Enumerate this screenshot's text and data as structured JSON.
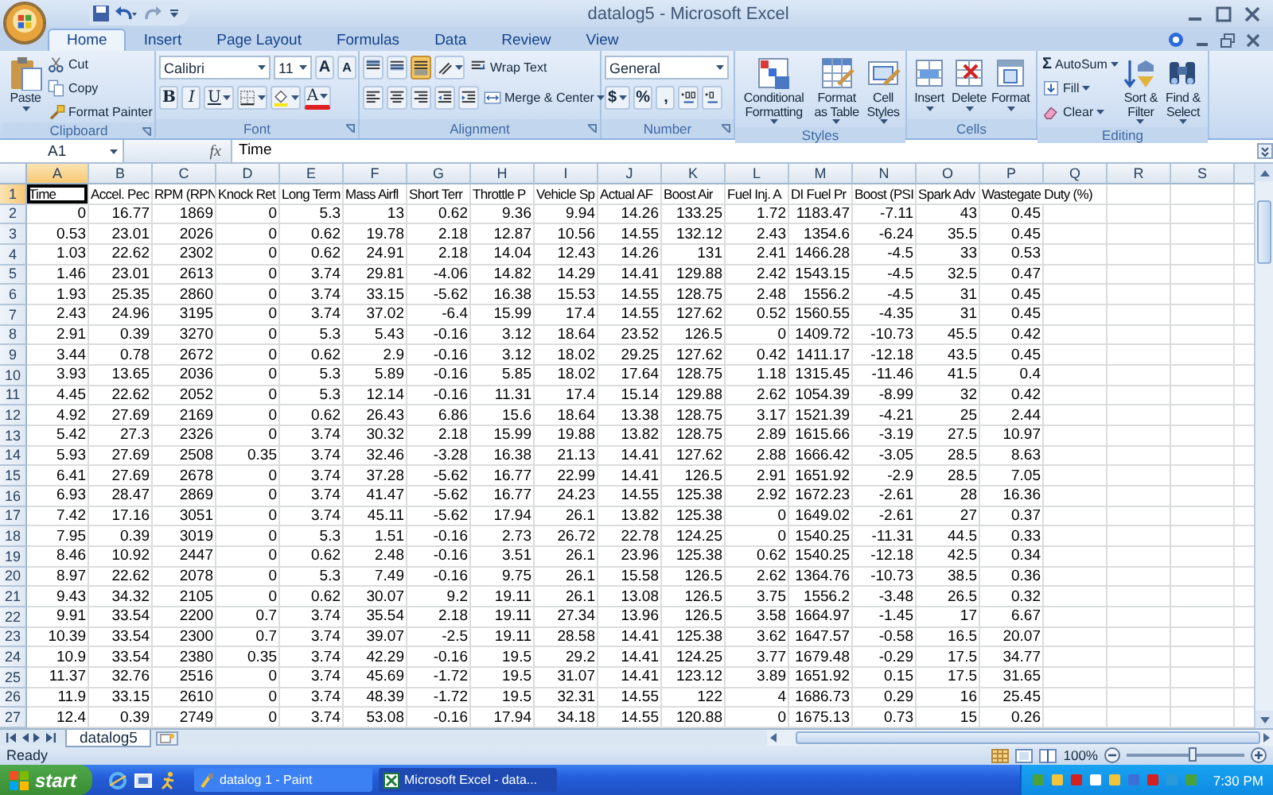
{
  "window": {
    "title": "datalog5 - Microsoft Excel"
  },
  "ribbon_tabs": [
    {
      "label": "Home",
      "selected": true
    },
    {
      "label": "Insert",
      "selected": false
    },
    {
      "label": "Page Layout",
      "selected": false
    },
    {
      "label": "Formulas",
      "selected": false
    },
    {
      "label": "Data",
      "selected": false
    },
    {
      "label": "Review",
      "selected": false
    },
    {
      "label": "View",
      "selected": false
    }
  ],
  "ribbon_groups": [
    {
      "name": "Clipboard",
      "blocks": [
        {
          "kind": "large",
          "label": "Paste",
          "menu": true
        },
        {
          "kind": "stack",
          "rows": [
            {
              "items": [
                {
                  "kind": "small",
                  "label": "Cut",
                  "menu": false
                }
              ]
            },
            {
              "items": [
                {
                  "kind": "small",
                  "label": "Copy",
                  "menu": false
                }
              ]
            },
            {
              "items": [
                {
                  "kind": "small",
                  "label": "Format Painter",
                  "menu": false
                }
              ]
            }
          ]
        }
      ]
    },
    {
      "name": "Font",
      "blocks": [
        {
          "kind": "stack",
          "rows": [
            {
              "items": [
                {
                  "kind": "combo",
                  "value": "Calibri"
                },
                {
                  "kind": "combo",
                  "value": "11"
                },
                {
                  "kind": "glyph",
                  "label": "A",
                  "on": false,
                  "menu": false
                },
                {
                  "kind": "glyph",
                  "label": "A",
                  "on": false,
                  "menu": false
                }
              ]
            },
            {
              "items": [
                {
                  "kind": "glyph",
                  "label": "B",
                  "on": false,
                  "menu": false
                },
                {
                  "kind": "glyph",
                  "label": "I",
                  "on": false,
                  "menu": false
                },
                {
                  "kind": "glyph",
                  "label": "U",
                  "on": false,
                  "menu": true
                },
                {
                  "kind": "tool",
                  "on": false,
                  "menu": true
                },
                {
                  "kind": "tool",
                  "on": false,
                  "menu": true
                },
                {
                  "kind": "glyph",
                  "label": "A",
                  "on": false,
                  "menu": true
                }
              ]
            }
          ]
        }
      ]
    },
    {
      "name": "Alignment",
      "blocks": [
        {
          "kind": "stack",
          "rows": [
            {
              "items": [
                {
                  "kind": "tool",
                  "on": false,
                  "menu": false
                },
                {
                  "kind": "tool",
                  "on": false,
                  "menu": false
                },
                {
                  "kind": "tool",
                  "on": true,
                  "menu": false
                },
                {
                  "kind": "tool",
                  "on": false,
                  "menu": true
                },
                {
                  "kind": "small",
                  "label": "Wrap Text",
                  "menu": false
                }
              ]
            },
            {
              "items": [
                {
                  "kind": "tool",
                  "on": false,
                  "menu": false
                },
                {
                  "kind": "tool",
                  "on": false,
                  "menu": false
                },
                {
                  "kind": "tool",
                  "on": false,
                  "menu": false
                },
                {
                  "kind": "tool",
                  "on": false,
                  "menu": false
                },
                {
                  "kind": "tool",
                  "on": false,
                  "menu": false
                },
                {
                  "kind": "small",
                  "label": "Merge & Center",
                  "menu": true
                }
              ]
            }
          ]
        }
      ]
    },
    {
      "name": "Number",
      "blocks": [
        {
          "kind": "stack",
          "rows": [
            {
              "items": [
                {
                  "kind": "combo",
                  "value": "General"
                }
              ]
            },
            {
              "items": [
                {
                  "kind": "glyph",
                  "label": "$",
                  "on": false,
                  "menu": true
                },
                {
                  "kind": "glyph",
                  "label": "%",
                  "on": false,
                  "menu": false
                },
                {
                  "kind": "glyph",
                  "label": ",",
                  "on": false,
                  "menu": false
                },
                {
                  "kind": "tool",
                  "on": false,
                  "menu": false
                },
                {
                  "kind": "tool",
                  "on": false,
                  "menu": false
                }
              ]
            }
          ]
        }
      ]
    },
    {
      "name": "Styles",
      "blocks": [
        {
          "kind": "large",
          "label": "Conditional Formatting",
          "menu": true
        },
        {
          "kind": "large",
          "label": "Format as Table",
          "menu": true
        },
        {
          "kind": "large",
          "label": "Cell Styles",
          "menu": true
        }
      ]
    },
    {
      "name": "Cells",
      "blocks": [
        {
          "kind": "large",
          "label": "Insert",
          "menu": true
        },
        {
          "kind": "large",
          "label": "Delete",
          "menu": true
        },
        {
          "kind": "large",
          "label": "Format",
          "menu": true
        }
      ]
    },
    {
      "name": "Editing",
      "blocks": [
        {
          "kind": "stack",
          "rows": [
            {
              "items": [
                {
                  "kind": "small",
                  "symbol": "Σ",
                  "label": "AutoSum",
                  "menu": true
                }
              ]
            },
            {
              "items": [
                {
                  "kind": "small",
                  "label": "Fill",
                  "menu": true
                }
              ]
            },
            {
              "items": [
                {
                  "kind": "small",
                  "label": "Clear",
                  "menu": true
                }
              ]
            }
          ]
        },
        {
          "kind": "large",
          "label": "Sort & Filter",
          "menu": true
        },
        {
          "kind": "large",
          "label": "Find & Select",
          "menu": true
        }
      ]
    }
  ],
  "formula_bar": {
    "name_box": "A1",
    "fx": "fx",
    "formula": "Time"
  },
  "sheet": {
    "columns": [
      {
        "label": "A",
        "selected": true
      },
      {
        "label": "B",
        "selected": false
      },
      {
        "label": "C",
        "selected": false
      },
      {
        "label": "D",
        "selected": false
      },
      {
        "label": "E",
        "selected": false
      },
      {
        "label": "F",
        "selected": false
      },
      {
        "label": "G",
        "selected": false
      },
      {
        "label": "H",
        "selected": false
      },
      {
        "label": "I",
        "selected": false
      },
      {
        "label": "J",
        "selected": false
      },
      {
        "label": "K",
        "selected": false
      },
      {
        "label": "L",
        "selected": false
      },
      {
        "label": "M",
        "selected": false
      },
      {
        "label": "N",
        "selected": false
      },
      {
        "label": "O",
        "selected": false
      },
      {
        "label": "P",
        "selected": false
      },
      {
        "label": "Q",
        "selected": false
      },
      {
        "label": "R",
        "selected": false
      },
      {
        "label": "S",
        "selected": false
      }
    ],
    "rows": [
      {
        "number": "1",
        "selected": true,
        "cells": [
          "Time",
          "Accel. Pec",
          "RPM (RPN",
          "Knock Ret",
          "Long Term",
          "Mass Airfl",
          "Short Terr",
          "Throttle P",
          "Vehicle Sp",
          "Actual AF",
          "Boost Air",
          "Fuel Inj. A",
          "DI Fuel Pr",
          "Boost (PSI",
          "Spark Adv",
          "Wastegate Duty (%)"
        ]
      },
      {
        "number": "2",
        "selected": false,
        "cells": [
          "0",
          "16.77",
          "1869",
          "0",
          "5.3",
          "13",
          "0.62",
          "9.36",
          "9.94",
          "14.26",
          "133.25",
          "1.72",
          "1183.47",
          "-7.11",
          "43",
          "0.45"
        ]
      },
      {
        "number": "3",
        "selected": false,
        "cells": [
          "0.53",
          "23.01",
          "2026",
          "0",
          "0.62",
          "19.78",
          "2.18",
          "12.87",
          "10.56",
          "14.55",
          "132.12",
          "2.43",
          "1354.6",
          "-6.24",
          "35.5",
          "0.45"
        ]
      },
      {
        "number": "4",
        "selected": false,
        "cells": [
          "1.03",
          "22.62",
          "2302",
          "0",
          "0.62",
          "24.91",
          "2.18",
          "14.04",
          "12.43",
          "14.26",
          "131",
          "2.41",
          "1466.28",
          "-4.5",
          "33",
          "0.53"
        ]
      },
      {
        "number": "5",
        "selected": false,
        "cells": [
          "1.46",
          "23.01",
          "2613",
          "0",
          "3.74",
          "29.81",
          "-4.06",
          "14.82",
          "14.29",
          "14.41",
          "129.88",
          "2.42",
          "1543.15",
          "-4.5",
          "32.5",
          "0.47"
        ]
      },
      {
        "number": "6",
        "selected": false,
        "cells": [
          "1.93",
          "25.35",
          "2860",
          "0",
          "3.74",
          "33.15",
          "-5.62",
          "16.38",
          "15.53",
          "14.55",
          "128.75",
          "2.48",
          "1556.2",
          "-4.5",
          "31",
          "0.45"
        ]
      },
      {
        "number": "7",
        "selected": false,
        "cells": [
          "2.43",
          "24.96",
          "3195",
          "0",
          "3.74",
          "37.02",
          "-6.4",
          "15.99",
          "17.4",
          "14.55",
          "127.62",
          "0.52",
          "1560.55",
          "-4.35",
          "31",
          "0.45"
        ]
      },
      {
        "number": "8",
        "selected": false,
        "cells": [
          "2.91",
          "0.39",
          "3270",
          "0",
          "5.3",
          "5.43",
          "-0.16",
          "3.12",
          "18.64",
          "23.52",
          "126.5",
          "0",
          "1409.72",
          "-10.73",
          "45.5",
          "0.42"
        ]
      },
      {
        "number": "9",
        "selected": false,
        "cells": [
          "3.44",
          "0.78",
          "2672",
          "0",
          "0.62",
          "2.9",
          "-0.16",
          "3.12",
          "18.02",
          "29.25",
          "127.62",
          "0.42",
          "1411.17",
          "-12.18",
          "43.5",
          "0.45"
        ]
      },
      {
        "number": "10",
        "selected": false,
        "cells": [
          "3.93",
          "13.65",
          "2036",
          "0",
          "5.3",
          "5.89",
          "-0.16",
          "5.85",
          "18.02",
          "17.64",
          "128.75",
          "1.18",
          "1315.45",
          "-11.46",
          "41.5",
          "0.4"
        ]
      },
      {
        "number": "11",
        "selected": false,
        "cells": [
          "4.45",
          "22.62",
          "2052",
          "0",
          "5.3",
          "12.14",
          "-0.16",
          "11.31",
          "17.4",
          "15.14",
          "129.88",
          "2.62",
          "1054.39",
          "-8.99",
          "32",
          "0.42"
        ]
      },
      {
        "number": "12",
        "selected": false,
        "cells": [
          "4.92",
          "27.69",
          "2169",
          "0",
          "0.62",
          "26.43",
          "6.86",
          "15.6",
          "18.64",
          "13.38",
          "128.75",
          "3.17",
          "1521.39",
          "-4.21",
          "25",
          "2.44"
        ]
      },
      {
        "number": "13",
        "selected": false,
        "cells": [
          "5.42",
          "27.3",
          "2326",
          "0",
          "3.74",
          "30.32",
          "2.18",
          "15.99",
          "19.88",
          "13.82",
          "128.75",
          "2.89",
          "1615.66",
          "-3.19",
          "27.5",
          "10.97"
        ]
      },
      {
        "number": "14",
        "selected": false,
        "cells": [
          "5.93",
          "27.69",
          "2508",
          "0.35",
          "3.74",
          "32.46",
          "-3.28",
          "16.38",
          "21.13",
          "14.41",
          "127.62",
          "2.88",
          "1666.42",
          "-3.05",
          "28.5",
          "8.63"
        ]
      },
      {
        "number": "15",
        "selected": false,
        "cells": [
          "6.41",
          "27.69",
          "2678",
          "0",
          "3.74",
          "37.28",
          "-5.62",
          "16.77",
          "22.99",
          "14.41",
          "126.5",
          "2.91",
          "1651.92",
          "-2.9",
          "28.5",
          "7.05"
        ]
      },
      {
        "number": "16",
        "selected": false,
        "cells": [
          "6.93",
          "28.47",
          "2869",
          "0",
          "3.74",
          "41.47",
          "-5.62",
          "16.77",
          "24.23",
          "14.55",
          "125.38",
          "2.92",
          "1672.23",
          "-2.61",
          "28",
          "16.36"
        ]
      },
      {
        "number": "17",
        "selected": false,
        "cells": [
          "7.42",
          "17.16",
          "3051",
          "0",
          "3.74",
          "45.11",
          "-5.62",
          "17.94",
          "26.1",
          "13.82",
          "125.38",
          "0",
          "1649.02",
          "-2.61",
          "27",
          "0.37"
        ]
      },
      {
        "number": "18",
        "selected": false,
        "cells": [
          "7.95",
          "0.39",
          "3019",
          "0",
          "5.3",
          "1.51",
          "-0.16",
          "2.73",
          "26.72",
          "22.78",
          "124.25",
          "0",
          "1540.25",
          "-11.31",
          "44.5",
          "0.33"
        ]
      },
      {
        "number": "19",
        "selected": false,
        "cells": [
          "8.46",
          "10.92",
          "2447",
          "0",
          "0.62",
          "2.48",
          "-0.16",
          "3.51",
          "26.1",
          "23.96",
          "125.38",
          "0.62",
          "1540.25",
          "-12.18",
          "42.5",
          "0.34"
        ]
      },
      {
        "number": "20",
        "selected": false,
        "cells": [
          "8.97",
          "22.62",
          "2078",
          "0",
          "5.3",
          "7.49",
          "-0.16",
          "9.75",
          "26.1",
          "15.58",
          "126.5",
          "2.62",
          "1364.76",
          "-10.73",
          "38.5",
          "0.36"
        ]
      },
      {
        "number": "21",
        "selected": false,
        "cells": [
          "9.43",
          "34.32",
          "2105",
          "0",
          "0.62",
          "30.07",
          "9.2",
          "19.11",
          "26.1",
          "13.08",
          "126.5",
          "3.75",
          "1556.2",
          "-3.48",
          "26.5",
          "0.32"
        ]
      },
      {
        "number": "22",
        "selected": false,
        "cells": [
          "9.91",
          "33.54",
          "2200",
          "0.7",
          "3.74",
          "35.54",
          "2.18",
          "19.11",
          "27.34",
          "13.96",
          "126.5",
          "3.58",
          "1664.97",
          "-1.45",
          "17",
          "6.67"
        ]
      },
      {
        "number": "23",
        "selected": false,
        "cells": [
          "10.39",
          "33.54",
          "2300",
          "0.7",
          "3.74",
          "39.07",
          "-2.5",
          "19.11",
          "28.58",
          "14.41",
          "125.38",
          "3.62",
          "1647.57",
          "-0.58",
          "16.5",
          "20.07"
        ]
      },
      {
        "number": "24",
        "selected": false,
        "cells": [
          "10.9",
          "33.54",
          "2380",
          "0.35",
          "3.74",
          "42.29",
          "-0.16",
          "19.5",
          "29.2",
          "14.41",
          "124.25",
          "3.77",
          "1679.48",
          "-0.29",
          "17.5",
          "34.77"
        ]
      },
      {
        "number": "25",
        "selected": false,
        "cells": [
          "11.37",
          "32.76",
          "2516",
          "0",
          "3.74",
          "45.69",
          "-1.72",
          "19.5",
          "31.07",
          "14.41",
          "123.12",
          "3.89",
          "1651.92",
          "0.15",
          "17.5",
          "31.65"
        ]
      },
      {
        "number": "26",
        "selected": false,
        "cells": [
          "11.9",
          "33.15",
          "2610",
          "0",
          "3.74",
          "48.39",
          "-1.72",
          "19.5",
          "32.31",
          "14.55",
          "122",
          "4",
          "1686.73",
          "0.29",
          "16",
          "25.45"
        ]
      },
      {
        "number": "27",
        "selected": false,
        "cells": [
          "12.4",
          "0.39",
          "2749",
          "0",
          "3.74",
          "53.08",
          "-0.16",
          "17.94",
          "34.18",
          "14.55",
          "120.88",
          "0",
          "1675.13",
          "0.73",
          "15",
          "0.26"
        ]
      }
    ]
  },
  "sheet_tabs": [
    {
      "label": "datalog5",
      "selected": true
    }
  ],
  "status_bar": {
    "status": "Ready",
    "zoom": {
      "label": "100%",
      "level": 0.55
    }
  },
  "taskbar": {
    "start": "start",
    "tasks": [
      {
        "label": "datalog 1 - Paint",
        "selected": false
      },
      {
        "label": "Microsoft Excel - data...",
        "selected": true
      }
    ],
    "clock": "7:30 PM"
  }
}
